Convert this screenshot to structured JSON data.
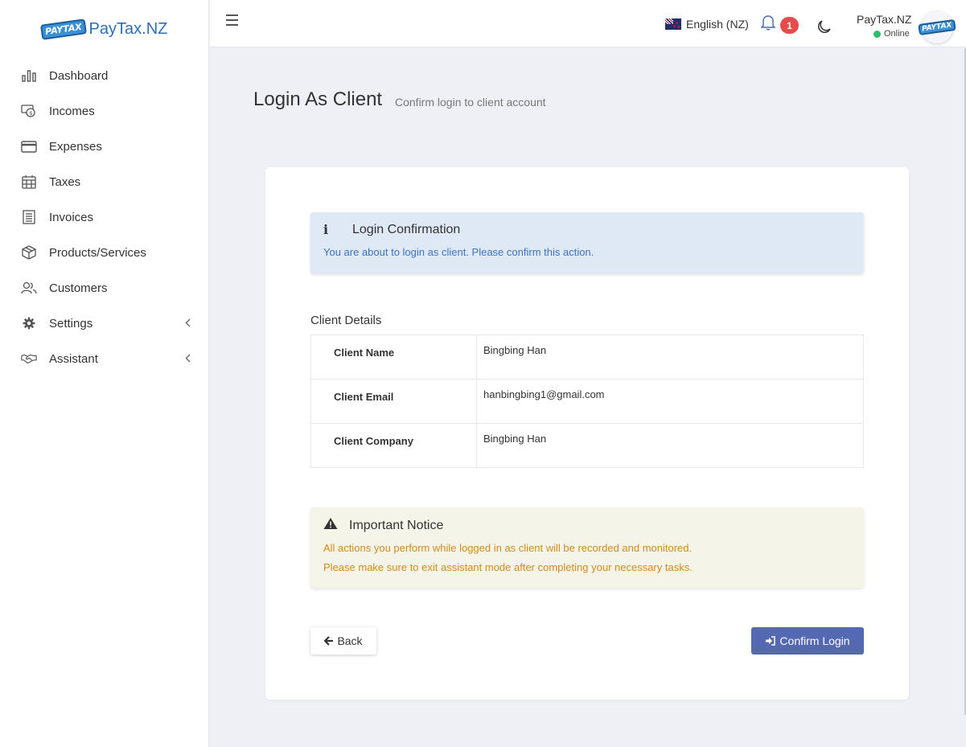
{
  "app": {
    "logo_badge": "PAYTAX",
    "logo_text": "PayTax.NZ"
  },
  "sidebar": {
    "items": [
      {
        "label": "Dashboard",
        "icon": "bar-chart-icon"
      },
      {
        "label": "Incomes",
        "icon": "money-icon"
      },
      {
        "label": "Expenses",
        "icon": "credit-card-icon"
      },
      {
        "label": "Taxes",
        "icon": "calendar-icon"
      },
      {
        "label": "Invoices",
        "icon": "invoice-icon"
      },
      {
        "label": "Products/Services",
        "icon": "box-icon"
      },
      {
        "label": "Customers",
        "icon": "users-icon"
      },
      {
        "label": "Settings",
        "icon": "gear-icon",
        "has_submenu": true
      },
      {
        "label": "Assistant",
        "icon": "handshake-icon",
        "has_submenu": true
      }
    ]
  },
  "topbar": {
    "language": "English (NZ)",
    "notification_count": "1",
    "user": {
      "name": "PayTax.NZ",
      "status": "Online"
    }
  },
  "page": {
    "title": "Login As Client",
    "subtitle": "Confirm login to client account"
  },
  "info_alert": {
    "title": "Login Confirmation",
    "message": "You are about to login as client. Please confirm this action."
  },
  "client_details": {
    "heading": "Client Details",
    "rows": [
      {
        "label": "Client Name",
        "value": "Bingbing Han"
      },
      {
        "label": "Client Email",
        "value": "hanbingbing1@gmail.com"
      },
      {
        "label": "Client Company",
        "value": "Bingbing Han"
      }
    ]
  },
  "warning_alert": {
    "title": "Important Notice",
    "lines": [
      "All actions you perform while logged in as client will be recorded and monitored.",
      "Please make sure to exit assistant mode after completing your necessary tasks."
    ]
  },
  "actions": {
    "back_label": "Back",
    "confirm_label": "Confirm Login"
  },
  "colors": {
    "primary": "#5568b2",
    "info_bg": "#dfe8f5",
    "info_text": "#3d74c1",
    "warning_bg": "#f5f4e9",
    "warning_text": "#d18a1c",
    "online": "#2dbd6e",
    "badge": "#e74c4c"
  }
}
